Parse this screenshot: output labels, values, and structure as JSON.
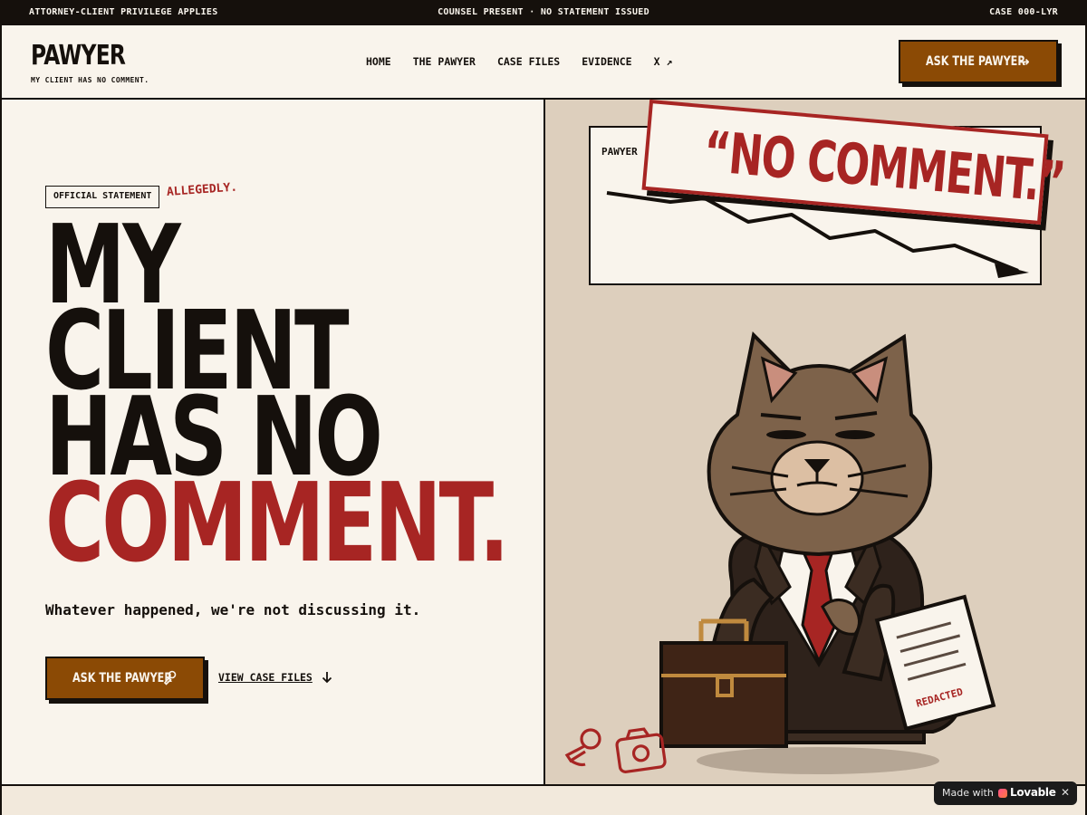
{
  "topbar": {
    "left": "ATTORNEY-CLIENT PRIVILEGE APPLIES",
    "center": "COUNSEL PRESENT · NO STATEMENT ISSUED",
    "right": "CASE 000-LYR"
  },
  "header": {
    "logo": "PAWYER",
    "tagline": "MY CLIENT HAS NO COMMENT.",
    "nav": [
      "HOME",
      "THE PAWYER",
      "CASE FILES",
      "EVIDENCE",
      "X ↗"
    ],
    "cta_label": "ASK THE PAWYER",
    "cta_icon": "arrow-right-icon"
  },
  "hero": {
    "badge": "OFFICIAL STATEMENT",
    "aside": "ALLEGEDLY.",
    "headline": [
      "MY",
      "CLIENT",
      "HAS NO",
      "COMMENT."
    ],
    "subline": "Whatever happened, we're not discussing it.",
    "cta_label": "ASK THE PAWYER",
    "cta_icon": "microphone-icon",
    "secondary_link": "VIEW CASE FILES",
    "secondary_icon": "arrow-down-icon"
  },
  "illustration": {
    "chart_brand": "PAWYER",
    "stamp": "“NO COMMENT.”",
    "document_label": "REDACTED"
  },
  "colors": {
    "ink": "#15100c",
    "paper": "#f9f4ec",
    "accent_red": "#a72523",
    "accent_brown": "#8b4a05",
    "panel_tan": "#ddcfbd"
  },
  "badge_lovable": {
    "made_with": "Made with",
    "brand": "Lovable",
    "close": "✕"
  }
}
